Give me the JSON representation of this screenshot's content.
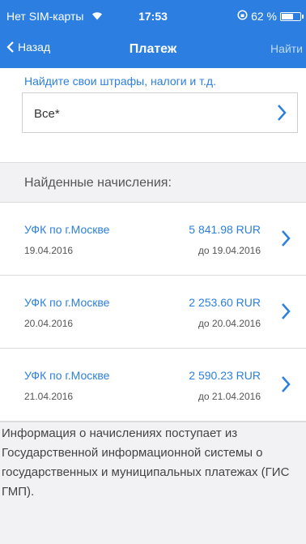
{
  "status_bar": {
    "carrier": "Нет SIM-карты",
    "time": "17:53",
    "battery_percent": "62 %",
    "battery_level": 0.62
  },
  "nav": {
    "back_label": "Назад",
    "title": "Платеж",
    "action_label": "Найти"
  },
  "search": {
    "hint": "Найдите свои штрафы, налоги и т.д.",
    "selected": "Все*"
  },
  "found_header": "Найденные начисления:",
  "charges": [
    {
      "org": "УФК по г.Москве",
      "date": "19.04.2016",
      "amount": "5 841.98 RUR",
      "due": "до 19.04.2016"
    },
    {
      "org": "УФК по г.Москве",
      "date": "20.04.2016",
      "amount": "2 253.60 RUR",
      "due": "до 20.04.2016"
    },
    {
      "org": "УФК по г.Москве",
      "date": "21.04.2016",
      "amount": "2 590.23 RUR",
      "due": "до 21.04.2016"
    }
  ],
  "info_text": "Информация о начислениях поступает из Государственной информационной системы о государственных и муниципальных платежах (ГИС ГМП).",
  "colors": {
    "accent": "#2c7fe0",
    "background": "#f2f2f4"
  }
}
